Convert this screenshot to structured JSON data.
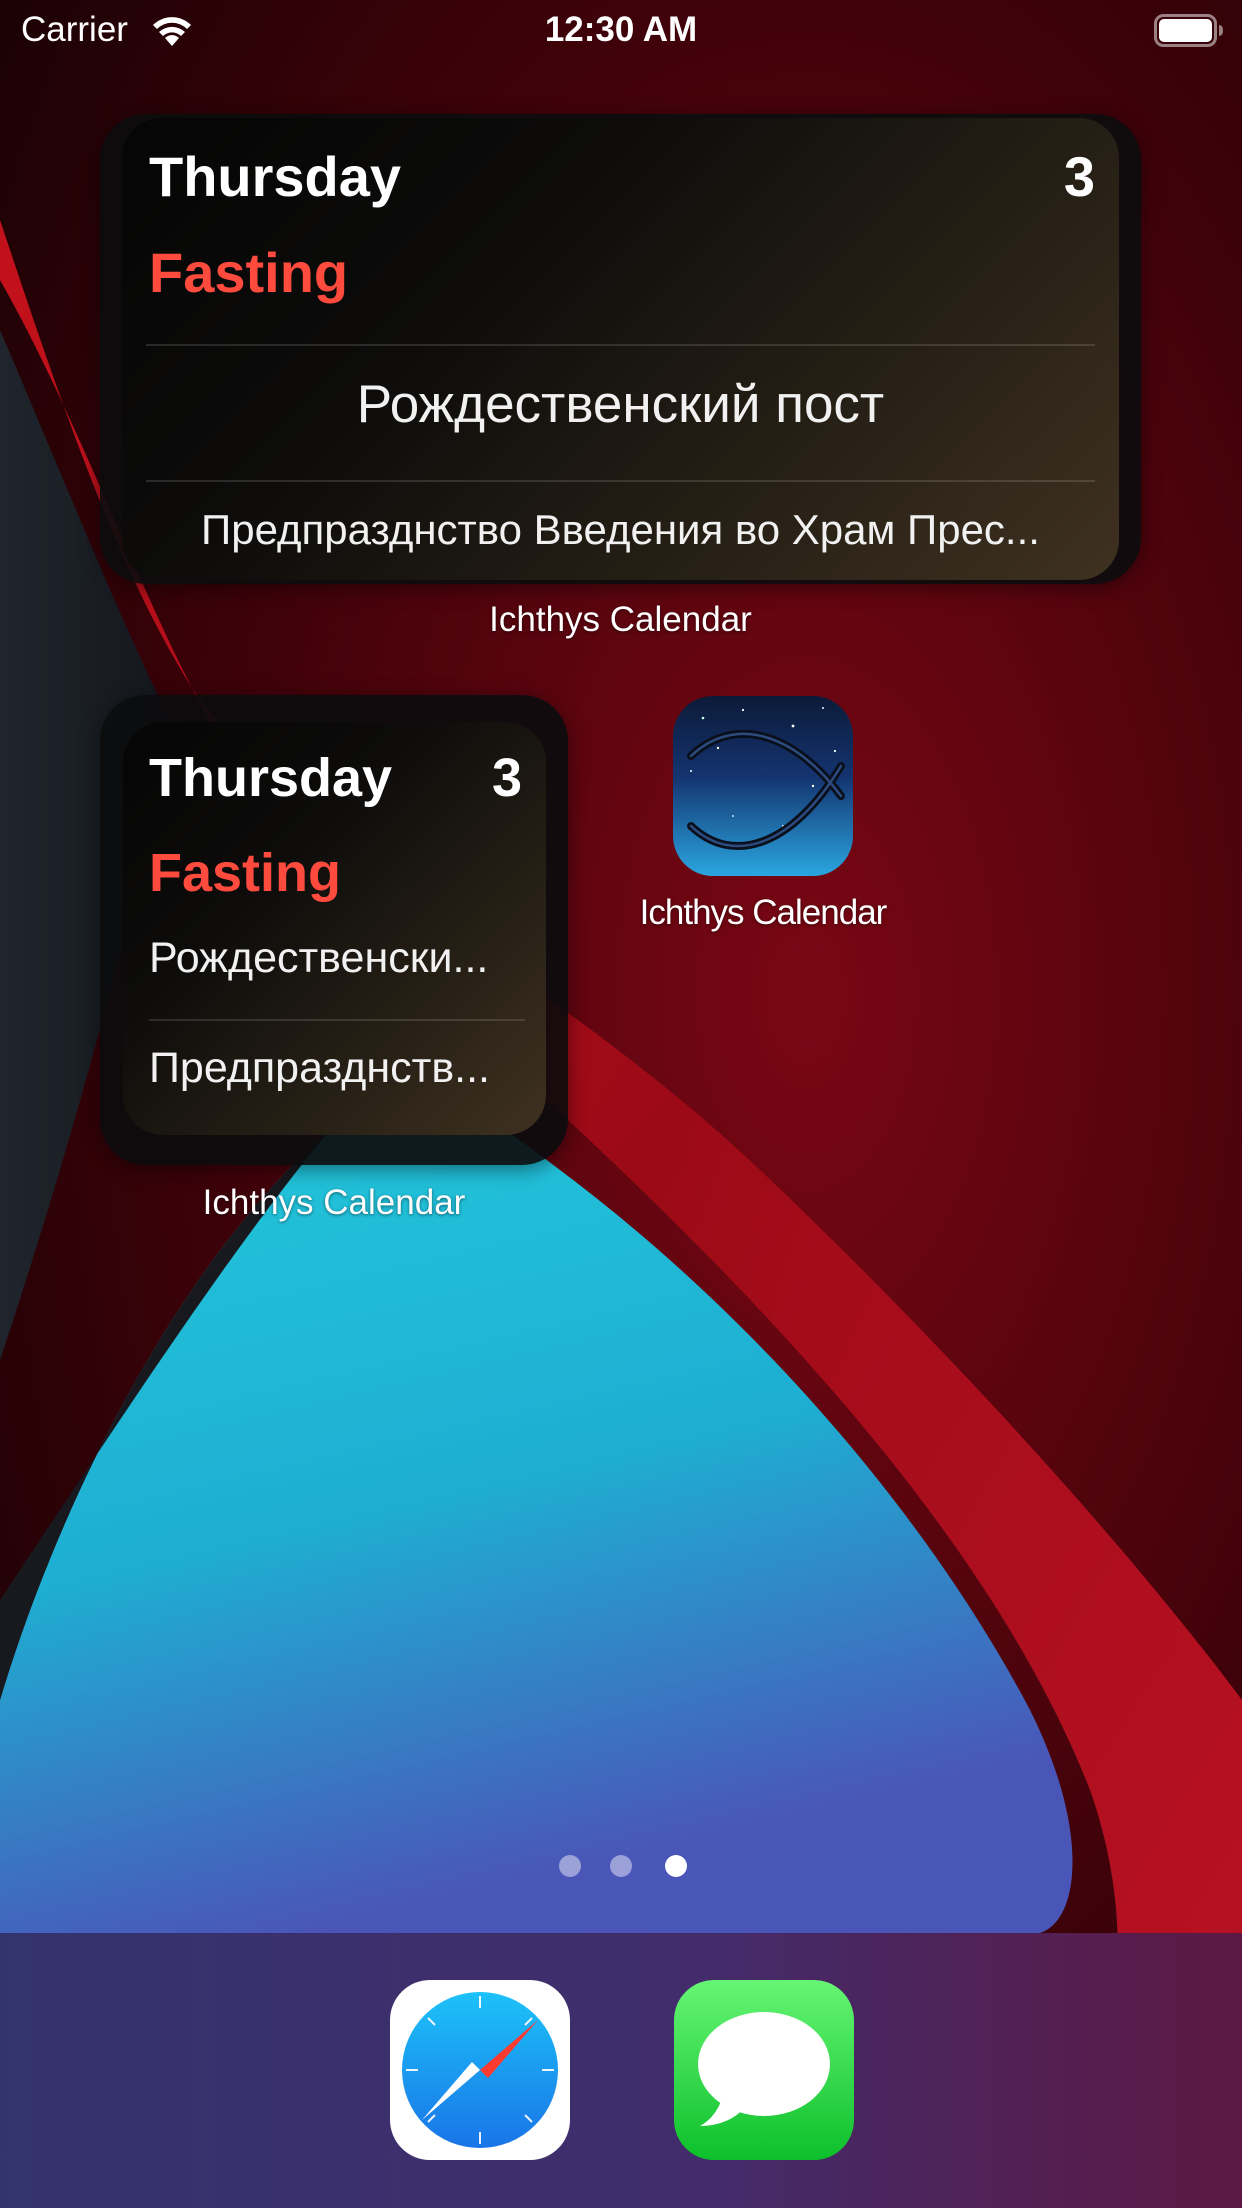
{
  "status_bar": {
    "carrier": "Carrier",
    "time": "12:30 AM"
  },
  "widget_medium": {
    "day": "Thursday",
    "date": "3",
    "status": "Fasting",
    "line1": "Рождественский пост",
    "line2": "Предпразднство Введения во Храм Прес...",
    "app_label": "Ichthys Calendar"
  },
  "widget_small": {
    "day": "Thursday",
    "date": "3",
    "status": "Fasting",
    "line1": "Рождественски...",
    "line2": "Предпразднств...",
    "app_label": "Ichthys Calendar"
  },
  "app_icon": {
    "label": "Ichthys Calendar",
    "icon": "ichthys-fish-icon"
  },
  "page_indicator": {
    "pages": 3,
    "current": 3
  },
  "dock": {
    "apps": [
      {
        "name": "Safari",
        "icon": "safari-compass-icon"
      },
      {
        "name": "Messages",
        "icon": "messages-bubble-icon"
      }
    ]
  },
  "colors": {
    "fasting_red": "#ff4b3e",
    "wallpaper_red": "#b0101e",
    "wallpaper_cyan": "#1fc0d6"
  }
}
